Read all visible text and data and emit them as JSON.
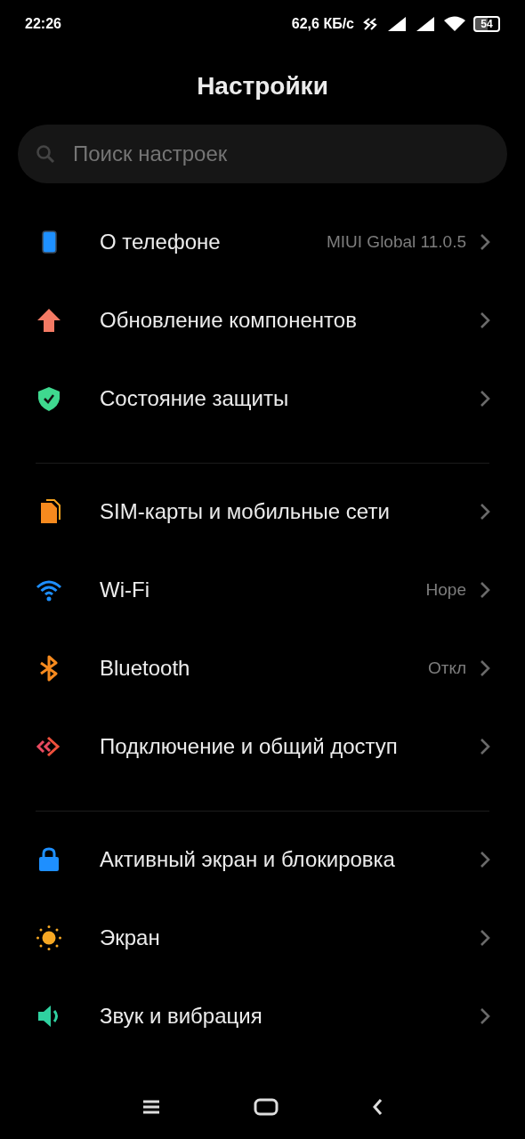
{
  "status_bar": {
    "time": "22:26",
    "speed": "62,6 КБ/с",
    "battery": "54"
  },
  "title": "Настройки",
  "search": {
    "placeholder": "Поиск настроек"
  },
  "groups": [
    {
      "items": [
        {
          "kind": "phone",
          "label": "О телефоне",
          "value": "MIUI Global 11.0.5"
        },
        {
          "kind": "update",
          "label": "Обновление компонентов"
        },
        {
          "kind": "shield",
          "label": "Состояние защиты"
        }
      ]
    },
    {
      "items": [
        {
          "kind": "sim",
          "label": "SIM-карты и мобильные сети"
        },
        {
          "kind": "wifi",
          "label": "Wi-Fi",
          "value": "Hope"
        },
        {
          "kind": "bluetooth",
          "label": "Bluetooth",
          "value": "Откл"
        },
        {
          "kind": "share",
          "label": "Подключение и общий доступ"
        }
      ]
    },
    {
      "items": [
        {
          "kind": "lock",
          "label": "Активный экран и блокировка"
        },
        {
          "kind": "sun",
          "label": "Экран"
        },
        {
          "kind": "sound",
          "label": "Звук и вибрация"
        }
      ]
    }
  ]
}
